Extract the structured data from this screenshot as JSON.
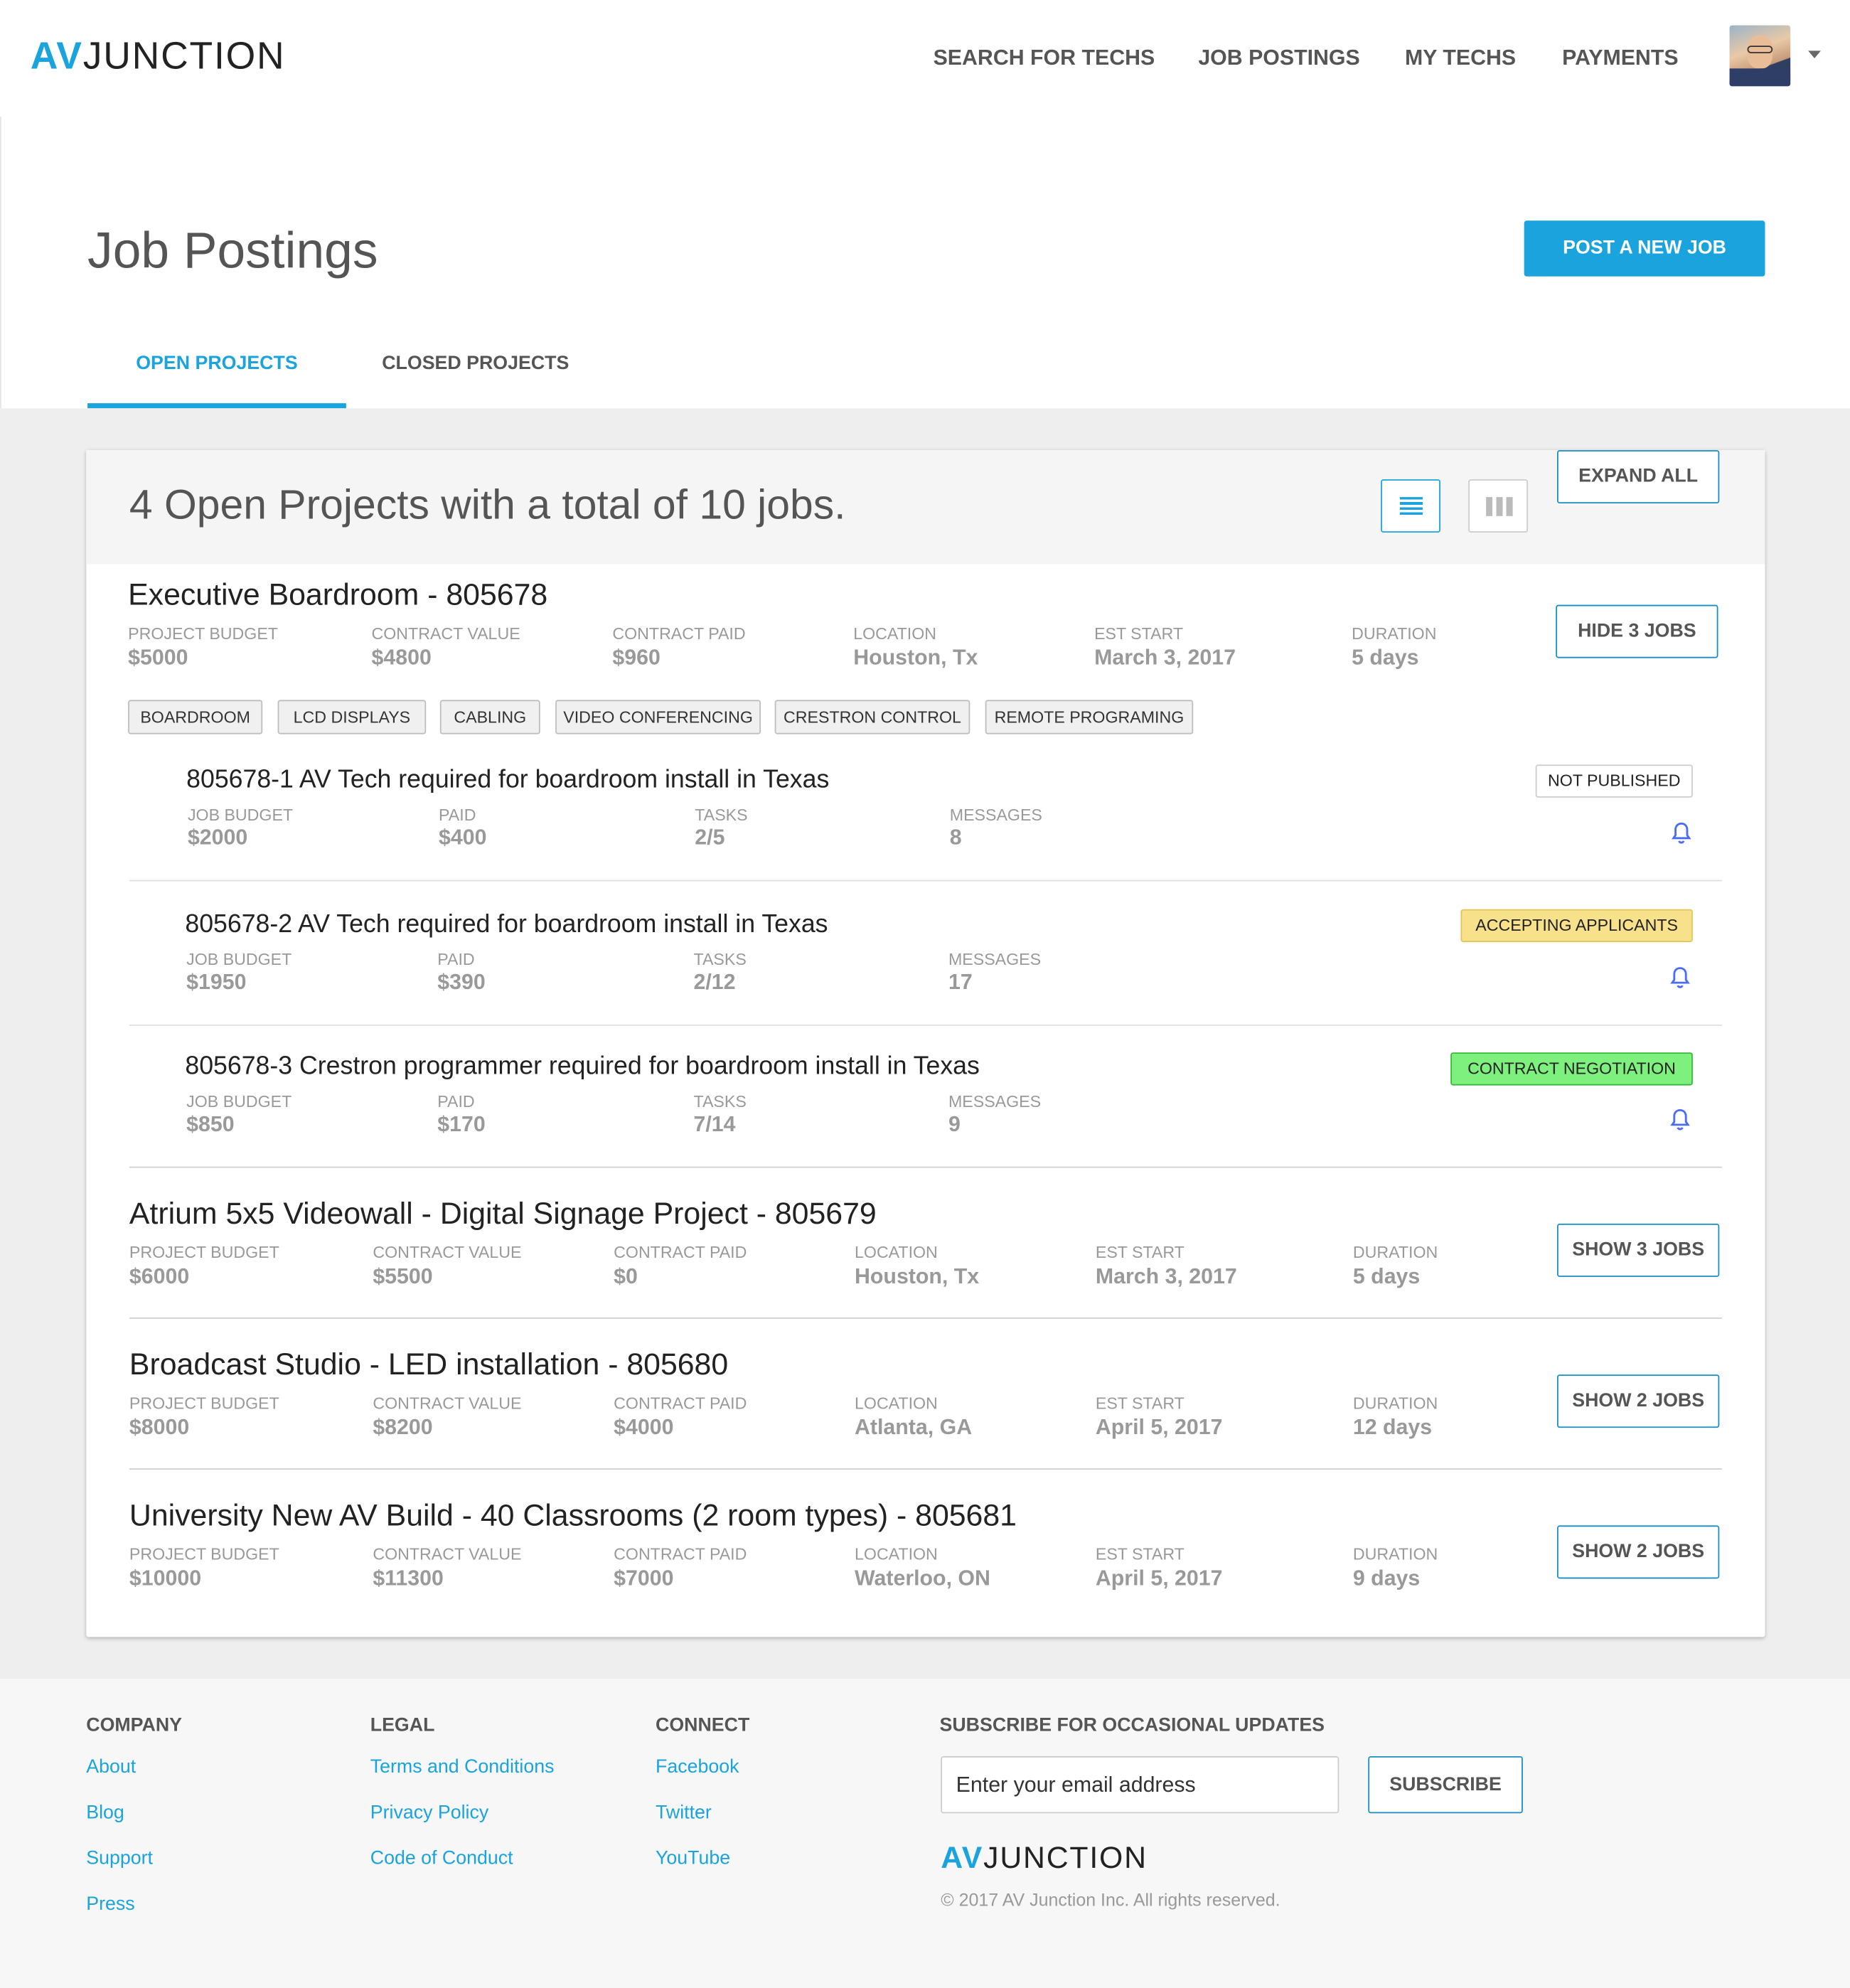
{
  "header": {
    "logo_av": "AV",
    "logo_junction": "JUNCTION",
    "nav": [
      "SEARCH FOR TECHS",
      "JOB POSTINGS",
      "MY TECHS",
      "PAYMENTS"
    ]
  },
  "page": {
    "title": "Job Postings",
    "post_button": "POST A NEW JOB",
    "tabs": [
      "OPEN PROJECTS",
      "CLOSED PROJECTS"
    ],
    "active_tab": "OPEN PROJECTS"
  },
  "summary": {
    "text": "4 Open Projects with a total of 10 jobs.",
    "expand_all": "EXPAND ALL"
  },
  "labels": {
    "project_budget": "PROJECT BUDGET",
    "contract_value": "CONTRACT VALUE",
    "contract_paid": "CONTRACT PAID",
    "location": "LOCATION",
    "est_start": "EST START",
    "duration": "DURATION",
    "job_budget": "JOB BUDGET",
    "paid": "PAID",
    "tasks": "TASKS",
    "messages": "MESSAGES"
  },
  "projects": [
    {
      "title": "Executive Boardroom - 805678",
      "budget": "$5000",
      "contract_value": "$4800",
      "contract_paid": "$960",
      "location": "Houston, Tx",
      "est_start": "March 3, 2017",
      "duration": "5 days",
      "toggle": "HIDE 3 JOBS",
      "tags": [
        "BOARDROOM",
        "LCD DISPLAYS",
        "CABLING",
        "VIDEO CONFERENCING",
        "CRESTRON CONTROL",
        "REMOTE PROGRAMING"
      ],
      "jobs": [
        {
          "title": "805678-1 AV Tech required for boardroom install in Texas",
          "budget": "$2000",
          "paid": "$400",
          "tasks": "2/5",
          "messages": "8",
          "status": "NOT PUBLISHED"
        },
        {
          "title": "805678-2 AV Tech required for boardroom install in Texas",
          "budget": "$1950",
          "paid": "$390",
          "tasks": "2/12",
          "messages": "17",
          "status": "ACCEPTING APPLICANTS"
        },
        {
          "title": "805678-3 Crestron programmer required for boardroom install in Texas",
          "budget": "$850",
          "paid": "$170",
          "tasks": "7/14",
          "messages": "9",
          "status": "CONTRACT NEGOTIATION"
        }
      ]
    },
    {
      "title": "Atrium 5x5 Videowall - Digital Signage Project - 805679",
      "budget": "$6000",
      "contract_value": "$5500",
      "contract_paid": "$0",
      "location": "Houston, Tx",
      "est_start": "March 3, 2017",
      "duration": "5 days",
      "toggle": "SHOW 3 JOBS"
    },
    {
      "title": "Broadcast Studio - LED installation - 805680",
      "budget": "$8000",
      "contract_value": "$8200",
      "contract_paid": "$4000",
      "location": "Atlanta, GA",
      "est_start": "April 5, 2017",
      "duration": "12 days",
      "toggle": "SHOW 2 JOBS"
    },
    {
      "title": "University New AV Build - 40 Classrooms (2 room types) - 805681",
      "budget": "$10000",
      "contract_value": "$11300",
      "contract_paid": "$7000",
      "location": "Waterloo, ON",
      "est_start": "April 5, 2017",
      "duration": "9 days",
      "toggle": "SHOW 2 JOBS"
    }
  ],
  "footer": {
    "company": {
      "heading": "COMPANY",
      "links": [
        "About",
        "Blog",
        "Support",
        "Press"
      ]
    },
    "legal": {
      "heading": "LEGAL",
      "links": [
        "Terms and Conditions",
        "Privacy Policy",
        "Code of Conduct"
      ]
    },
    "connect": {
      "heading": "CONNECT",
      "links": [
        "Facebook",
        "Twitter",
        "YouTube"
      ]
    },
    "subscribe_heading": "SUBSCRIBE FOR OCCASIONAL UPDATES",
    "email_placeholder": "Enter your email address",
    "subscribe_button": "SUBSCRIBE",
    "logo_av": "AV",
    "logo_junction": "JUNCTION",
    "copyright": "© 2017 AV Junction Inc. All rights reserved."
  },
  "colors": {
    "accent": "#1aa3dd",
    "status_accepting": "#f7e18a",
    "status_negotiation": "#7df07d",
    "bell": "#4a6cf7"
  },
  "icons": [
    "list-view-icon",
    "column-view-icon",
    "bell-icon",
    "chevron-down-icon",
    "avatar"
  ]
}
